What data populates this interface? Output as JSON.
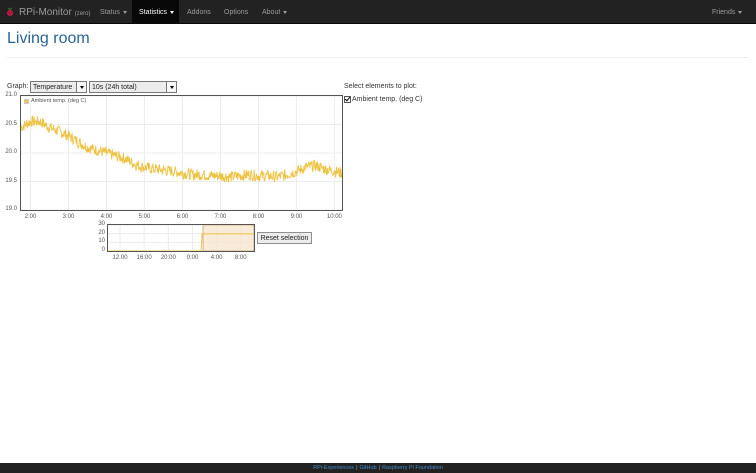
{
  "navbar": {
    "brand": "RPi-Monitor",
    "brand_sub": "(zero)",
    "items": [
      {
        "label": "Status"
      },
      {
        "label": "Statistics"
      },
      {
        "label": "Addons"
      },
      {
        "label": "Options"
      },
      {
        "label": "About"
      }
    ],
    "friends": "Friends"
  },
  "page": {
    "title": "Living room"
  },
  "controls": {
    "graph_label": "Graph:",
    "graph_select": "Temperature",
    "range_select": "10s (24h total)",
    "select_title": "Select elements to plot:",
    "series_label": "Ambient temp. (deg C)",
    "series_checked": true,
    "reset_label": "Reset selection"
  },
  "colors": {
    "series": "#edc240",
    "navbar": "#222222",
    "title": "#2a6496",
    "selection_fill": "#f6e6cf",
    "selection_border": "#d4b483"
  },
  "chart_data": [
    {
      "type": "line",
      "legend": "Ambient temp. (deg C)",
      "legend_position": "top-left",
      "grid": true,
      "x_ticks": [
        "2:00",
        "3:00",
        "4:00",
        "5:00",
        "6:00",
        "7:00",
        "8:00",
        "9:00",
        "10:00"
      ],
      "y_ticks": [
        "19.0",
        "19.5",
        "20.0",
        "20.5",
        "21.0"
      ],
      "ylim": [
        19.0,
        21.0
      ],
      "xlim_hours": [
        1.75,
        10.2
      ],
      "series": [
        {
          "name": "Ambient temp. (deg C)",
          "x_hours": [
            1.75,
            2.0,
            2.25,
            2.5,
            2.75,
            3.0,
            3.25,
            3.5,
            3.75,
            4.0,
            4.25,
            4.5,
            4.75,
            5.0,
            5.25,
            5.5,
            5.75,
            6.0,
            6.25,
            6.5,
            6.75,
            7.0,
            7.25,
            7.5,
            7.75,
            8.0,
            8.25,
            8.5,
            8.75,
            9.0,
            9.25,
            9.5,
            9.75,
            10.0,
            10.2
          ],
          "values": [
            20.45,
            20.55,
            20.55,
            20.45,
            20.38,
            20.3,
            20.2,
            20.1,
            20.05,
            20.0,
            19.95,
            19.9,
            19.8,
            19.75,
            19.72,
            19.7,
            19.68,
            19.65,
            19.62,
            19.62,
            19.6,
            19.6,
            19.58,
            19.6,
            19.62,
            19.6,
            19.6,
            19.58,
            19.62,
            19.68,
            19.75,
            19.78,
            19.72,
            19.68,
            19.65
          ],
          "noise_amplitude": 0.1
        }
      ]
    },
    {
      "type": "line",
      "x_ticks": [
        "12:00",
        "16:00",
        "20:00",
        "0:00",
        "4:00",
        "8:00"
      ],
      "y_ticks": [
        "0",
        "10",
        "20",
        "30"
      ],
      "ylim": [
        0,
        30
      ],
      "xlim_hours": [
        10.0,
        34.2
      ],
      "series": [
        {
          "name": "Ambient temp. (deg C)",
          "x_hours": [
            10.0,
            25.4,
            25.6,
            34.2
          ],
          "values": [
            0,
            0,
            19.7,
            19.7
          ]
        }
      ],
      "selection_hours": [
        25.75,
        34.2
      ]
    }
  ],
  "footer": {
    "link1": "RPi-Experiences",
    "link2": "GitHub",
    "link3": "Raspberry Pi Foundation",
    "separator": "|"
  }
}
